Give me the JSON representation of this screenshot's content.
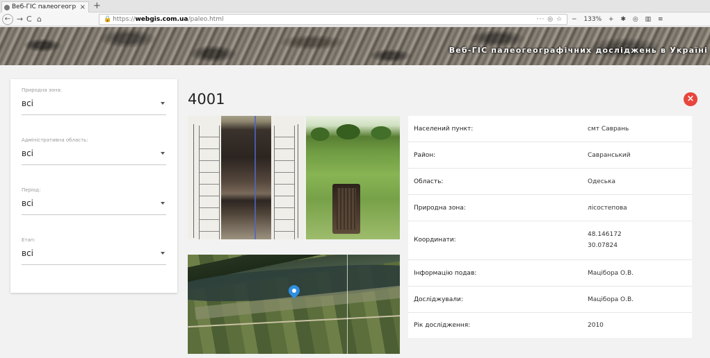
{
  "browser": {
    "tab_title": "Веб-ГІС палеогеогр",
    "url_scheme": "https://",
    "url_host": "webgis.com.ua",
    "url_path": "/paleo.html",
    "url_tools": "··· ◎ ☆",
    "zoom": "133%"
  },
  "site": {
    "title": "Веб-ГІС палеогеографічних досліджень в Україні"
  },
  "filters": [
    {
      "label": "Природна зона:",
      "value": "всі"
    },
    {
      "label": "Адміністративна область:",
      "value": "всі"
    },
    {
      "label": "Період:",
      "value": "всі"
    },
    {
      "label": "Етап:",
      "value": "всі"
    }
  ],
  "record": {
    "id": "4001",
    "fields": [
      {
        "key": "Населений пункт:",
        "value": "смт Саврань"
      },
      {
        "key": "Район:",
        "value": "Савранський"
      },
      {
        "key": "Область:",
        "value": "Одеська"
      },
      {
        "key": "Природна зона:",
        "value": "лісостепова"
      },
      {
        "key": "Координати:",
        "value": "48.146172",
        "value2": "30.07824"
      },
      {
        "key": "Інформацію подав:",
        "value": "Мацібора О.В."
      },
      {
        "key": "Досліджували:",
        "value": "Мацібора О.В."
      },
      {
        "key": "Рік дослідження:",
        "value": "2010"
      }
    ]
  },
  "colors": {
    "close_button": "#e8453c",
    "map_pin": "#2f8fe0"
  }
}
